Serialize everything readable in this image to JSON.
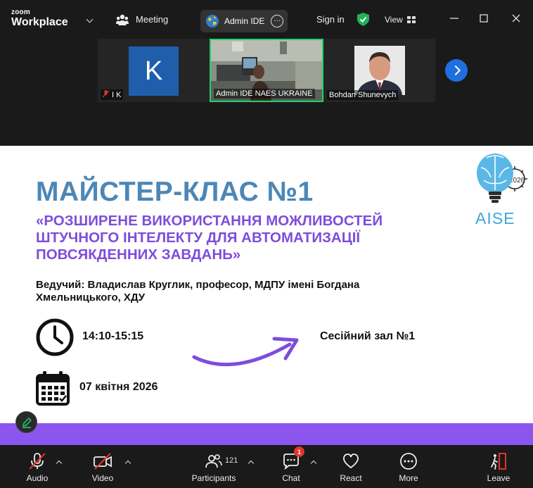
{
  "titlebar": {
    "logo_small": "zoom",
    "logo_big": "Workplace",
    "meeting_label": "Meeting",
    "active_tab_label": "Admin IDE",
    "sign_in_label": "Sign in",
    "view_label": "View"
  },
  "video_strip": {
    "participants": [
      {
        "name": "I K",
        "avatar_letter": "K",
        "muted": true
      },
      {
        "name": "Admin IDE NAES UKRAINE",
        "active_speaker": true
      },
      {
        "name": "Bohdan Shunevych"
      }
    ]
  },
  "slide": {
    "title": "МАЙСТЕР-КЛАС №1",
    "subtitle": "«РОЗШИРЕНЕ ВИКОРИСТАННЯ МОЖЛИВОСТЕЙ\nШТУЧНОГО ІНТЕЛЕКТУ ДЛЯ АВТОМАТИЗАЦІЇ\nПОВСЯКДЕННИХ ЗАВДАНЬ»",
    "host": "Ведучий: Владислав Круглик, професор, МДПУ імені Богдана Хмельницького, ХДУ",
    "time": "14:10-15:15",
    "date": "07 квітня 2026",
    "hall": "Сесійний зал №1",
    "logo_text": "AISE",
    "logo_year": "2026"
  },
  "toolbar": {
    "audio_label": "Audio",
    "video_label": "Video",
    "participants_label": "Participants",
    "participants_count": "121",
    "chat_label": "Chat",
    "chat_badge": "1",
    "react_label": "React",
    "more_label": "More",
    "leave_label": "Leave"
  },
  "colors": {
    "title_blue": "#4d87b6",
    "subtitle_purple": "#7e4ddb",
    "bar_purple": "#8a56ee",
    "active_green": "#1fd36e",
    "leave_red": "#e5322d",
    "accent_blue": "#1f6fe0"
  }
}
